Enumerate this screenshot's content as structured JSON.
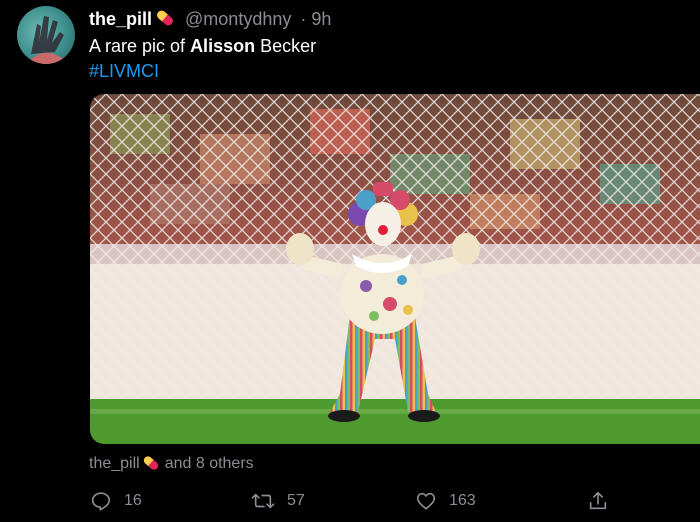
{
  "tweet": {
    "display_name": "the_pill",
    "handle": "@montydhny",
    "separator": "·",
    "time": "9h",
    "text_before": "A rare pic of ",
    "text_bold": "Alisson",
    "text_after": " Becker",
    "hashtag": "#LIVMCI"
  },
  "liked_by": {
    "name": "the_pill",
    "suffix": "and 8 others"
  },
  "actions": {
    "reply_count": "16",
    "retweet_count": "57",
    "like_count": "163"
  },
  "colors": {
    "background": "#000000",
    "link": "#1d9bf0",
    "muted": "#8a8d91",
    "pill_red": "#e0245e",
    "pill_yellow": "#ffcc4d"
  },
  "icons": [
    "pill-icon",
    "reply-icon",
    "retweet-icon",
    "like-icon",
    "share-icon"
  ]
}
